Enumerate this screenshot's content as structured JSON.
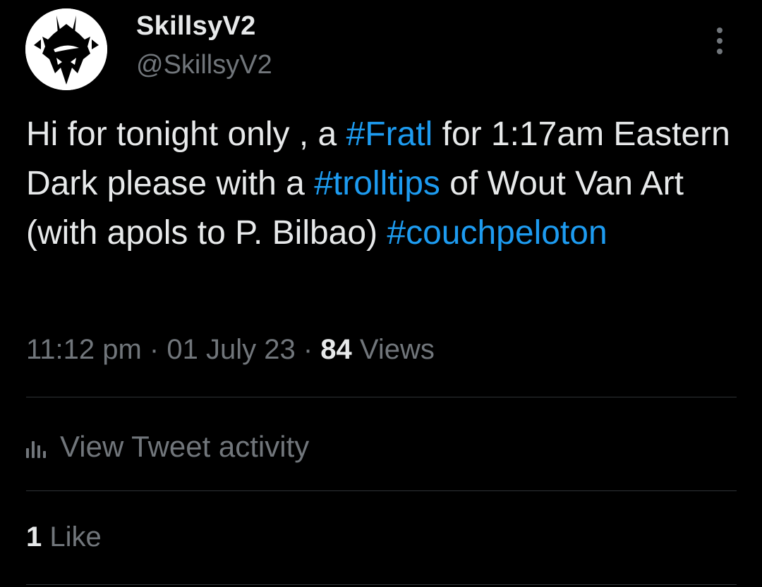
{
  "author": {
    "display_name": "SkillsyV2",
    "handle": "@SkillsyV2",
    "avatar_icon": "skull-mask-logo-icon"
  },
  "tweet": {
    "text_1": "Hi for tonight only , a ",
    "hashtag_1": "#Fratl",
    "text_2": " for 1:17am Eastern Dark please with a ",
    "hashtag_2": "#trolltips",
    "text_3": " of Wout Van Art (with apols to P. Bilbao) ",
    "hashtag_3": "#couchpeloton"
  },
  "meta": {
    "time": "11:12 pm",
    "separator": " · ",
    "date": "01 July 23",
    "views_count": "84",
    "views_label": "Views"
  },
  "activity": {
    "icon": "bar-chart-icon",
    "label": "View Tweet activity"
  },
  "engagement": {
    "likes_count": "1",
    "likes_label": "Like"
  },
  "menu": {
    "icon": "more-vertical-icon"
  },
  "colors": {
    "background": "#000000",
    "text_primary": "#e7e9ea",
    "text_secondary": "#71767b",
    "accent": "#1d9bf0",
    "divider": "#2f3336"
  }
}
